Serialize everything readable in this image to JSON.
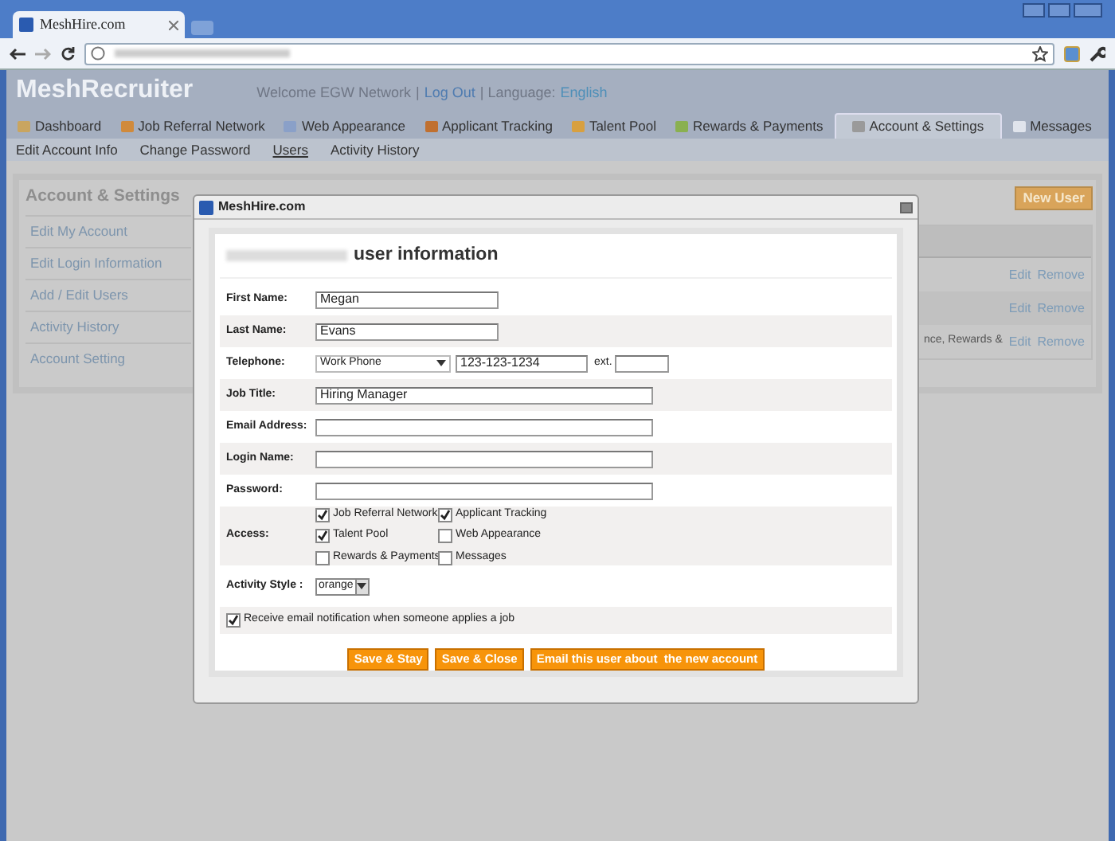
{
  "browser": {
    "tab_title": "MeshHire.com"
  },
  "header": {
    "logo": "MeshRecruiter",
    "welcome": "Welcome EGW Network",
    "sep1": "|",
    "logout": "Log Out",
    "language_label": "| Language:",
    "language": "English"
  },
  "nav_tabs": [
    {
      "label": "Dashboard",
      "selected": false
    },
    {
      "label": "Job Referral Network",
      "selected": false
    },
    {
      "label": "Web Appearance",
      "selected": false
    },
    {
      "label": "Applicant Tracking",
      "selected": false
    },
    {
      "label": "Talent Pool",
      "selected": false
    },
    {
      "label": "Rewards & Payments",
      "selected": false
    },
    {
      "label": "Account & Settings",
      "selected": true
    },
    {
      "label": "Messages",
      "selected": false
    }
  ],
  "sub_nav": [
    {
      "label": "Edit Account Info",
      "selected": false
    },
    {
      "label": "Change Password",
      "selected": false
    },
    {
      "label": "Users",
      "selected": true
    },
    {
      "label": "Activity History",
      "selected": false
    }
  ],
  "sidebar": {
    "title": "Account & Settings",
    "items": [
      "Edit My Account",
      "Edit Login Information",
      "Add / Edit Users",
      "Activity History",
      "Account Setting"
    ]
  },
  "new_user_button": "New User",
  "users_table": {
    "rows": [
      {
        "edit": "Edit",
        "remove": "Remove"
      },
      {
        "edit": "Edit",
        "remove": "Remove"
      },
      {
        "text": "nce, Rewards &",
        "edit": "Edit",
        "remove": "Remove"
      }
    ]
  },
  "modal": {
    "title": "MeshHire.com",
    "heading": "user information",
    "fields": [
      {
        "kind": "text",
        "label": "First Name:",
        "value": "Megan",
        "wide": false
      },
      {
        "kind": "text",
        "label": "Last Name:",
        "value": "Evans",
        "wide": false
      },
      {
        "kind": "phone",
        "label": "Telephone:",
        "type": "Work Phone",
        "value": "123-123-1234",
        "ext_label": "ext."
      },
      {
        "kind": "text",
        "label": "Job Title:",
        "value": "Hiring Manager",
        "wide": true
      },
      {
        "kind": "text",
        "label": "Email Address:",
        "wide": true
      },
      {
        "kind": "text",
        "label": "Login Name:",
        "wide": true
      },
      {
        "kind": "text",
        "label": "Password:",
        "wide": true
      },
      {
        "kind": "checkboxes",
        "label": "Access:",
        "options": [
          {
            "label": "Job Referral Network",
            "checked": true
          },
          {
            "label": "Applicant Tracking",
            "checked": true
          },
          {
            "label": "Talent Pool",
            "checked": true
          },
          {
            "label": "Web Appearance",
            "checked": false
          },
          {
            "label": "Rewards & Payments",
            "checked": false
          },
          {
            "label": "Messages",
            "checked": false
          }
        ]
      },
      {
        "kind": "select",
        "label": "Activity Style :",
        "value": "orange"
      },
      {
        "kind": "checkbox",
        "label": "Receive email notification when someone applies a job",
        "checked": true
      }
    ],
    "buttons": [
      "Save & Stay",
      "Save & Close",
      "Email this user about  the new account"
    ]
  }
}
